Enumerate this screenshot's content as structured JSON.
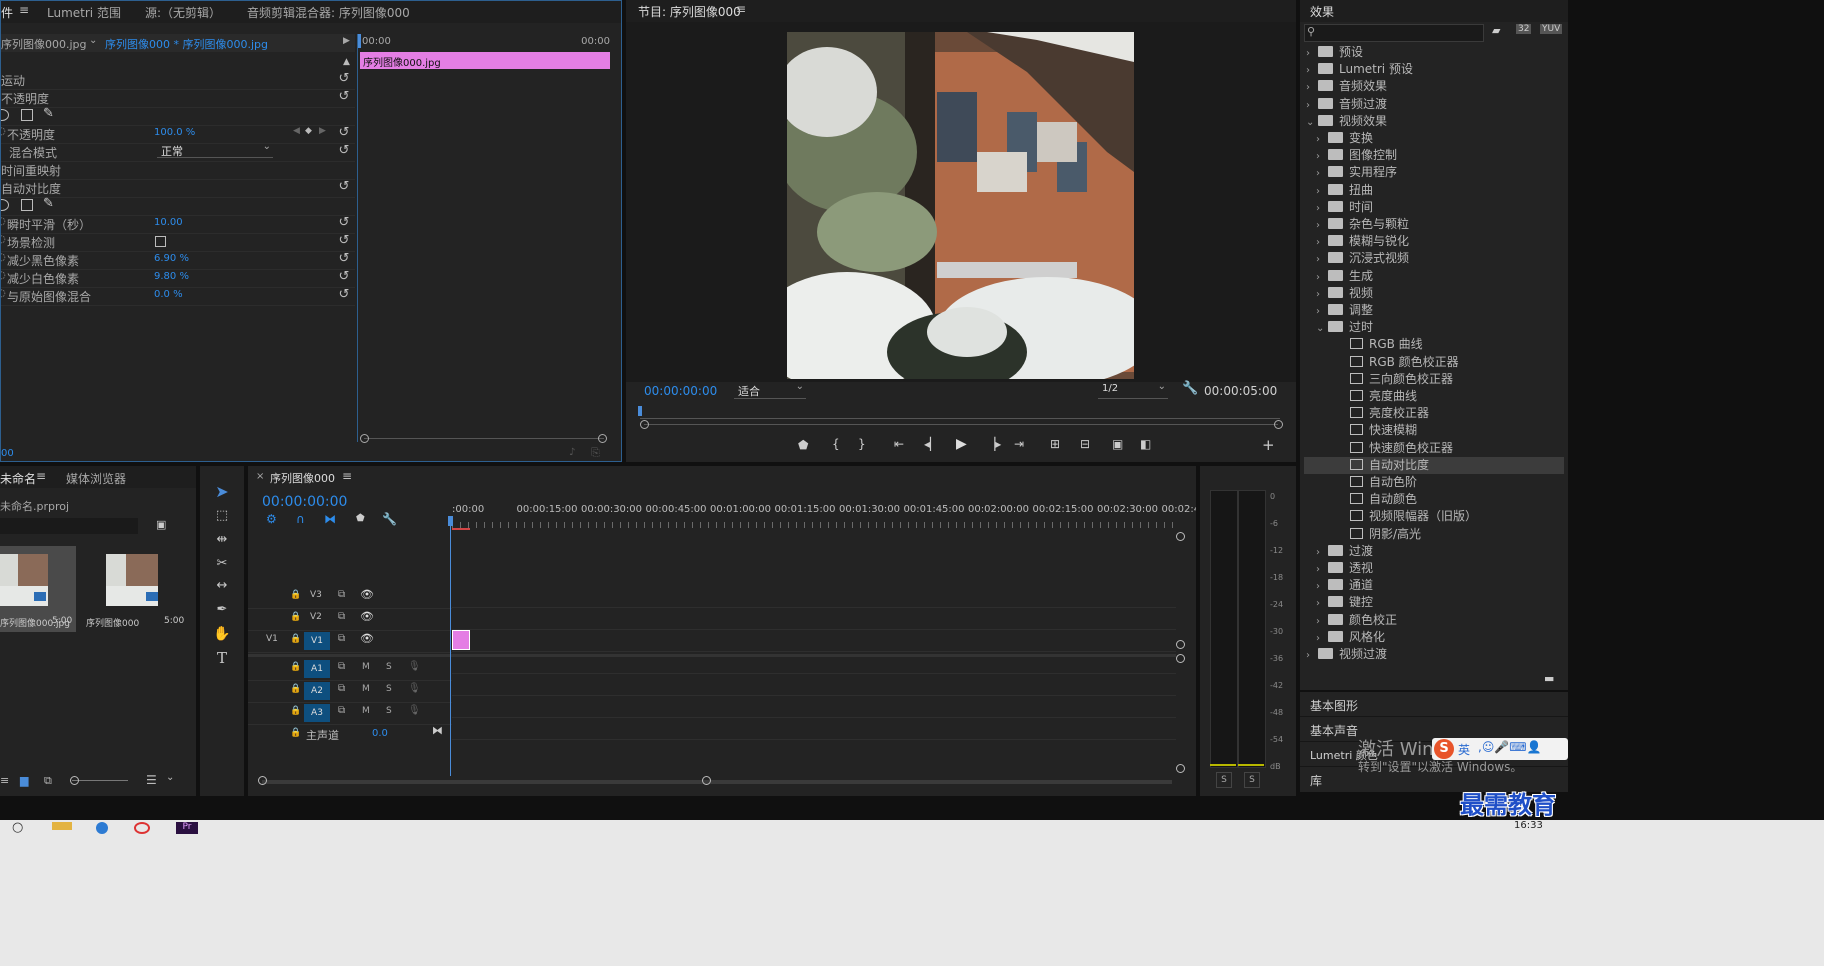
{
  "effect_controls": {
    "tabs": [
      "件",
      "Lumetri 范围",
      "源:（无剪辑）",
      "音频剪辑混合器: 序列图像000"
    ],
    "clip_path_master": "序列图像000.jpg",
    "clip_path_seq": "序列图像000 * 序列图像000.jpg",
    "time_start": "00:00",
    "time_end": "00:00",
    "clip_label": "序列图像000.jpg",
    "bottom_time": "00",
    "rows": {
      "motion": "运动",
      "opacity_group": "不透明度",
      "opacity": "不透明度",
      "opacity_value": "100.0 %",
      "blend": "混合模式",
      "blend_value": "正常",
      "time_remap": "时间重映射",
      "auto_contrast": "自动对比度",
      "temporal_smooth": "瞬时平滑（秒）",
      "temporal_smooth_value": "10.00",
      "scene_detect": "场景检测",
      "black_clip": "减少黑色像素",
      "black_clip_value": "6.90 %",
      "white_clip": "减少白色像素",
      "white_clip_value": "9.80 %",
      "blend_original": "与原始图像混合",
      "blend_original_value": "0.0 %"
    }
  },
  "program": {
    "title": "节目: 序列图像000",
    "timecode": "00:00:00:00",
    "fit": "适合",
    "resolution": "1/2",
    "duration": "00:00:05:00"
  },
  "effects": {
    "title": "效果",
    "items": [
      {
        "label": "预设",
        "level": 0,
        "kind": "folder",
        "open": false
      },
      {
        "label": "Lumetri 预设",
        "level": 0,
        "kind": "folder",
        "open": false
      },
      {
        "label": "音频效果",
        "level": 0,
        "kind": "folder",
        "open": false
      },
      {
        "label": "音频过渡",
        "level": 0,
        "kind": "folder",
        "open": false
      },
      {
        "label": "视频效果",
        "level": 0,
        "kind": "folder",
        "open": true
      },
      {
        "label": "变换",
        "level": 1,
        "kind": "folder",
        "open": false
      },
      {
        "label": "图像控制",
        "level": 1,
        "kind": "folder",
        "open": false
      },
      {
        "label": "实用程序",
        "level": 1,
        "kind": "folder",
        "open": false
      },
      {
        "label": "扭曲",
        "level": 1,
        "kind": "folder",
        "open": false
      },
      {
        "label": "时间",
        "level": 1,
        "kind": "folder",
        "open": false
      },
      {
        "label": "杂色与颗粒",
        "level": 1,
        "kind": "folder",
        "open": false
      },
      {
        "label": "模糊与锐化",
        "level": 1,
        "kind": "folder",
        "open": false
      },
      {
        "label": "沉浸式视频",
        "level": 1,
        "kind": "folder",
        "open": false
      },
      {
        "label": "生成",
        "level": 1,
        "kind": "folder",
        "open": false
      },
      {
        "label": "视频",
        "level": 1,
        "kind": "folder",
        "open": false
      },
      {
        "label": "调整",
        "level": 1,
        "kind": "folder",
        "open": false
      },
      {
        "label": "过时",
        "level": 1,
        "kind": "folder",
        "open": true
      },
      {
        "label": "RGB 曲线",
        "level": 2,
        "kind": "fx"
      },
      {
        "label": "RGB 颜色校正器",
        "level": 2,
        "kind": "fx"
      },
      {
        "label": "三向颜色校正器",
        "level": 2,
        "kind": "fx"
      },
      {
        "label": "亮度曲线",
        "level": 2,
        "kind": "fx"
      },
      {
        "label": "亮度校正器",
        "level": 2,
        "kind": "fx"
      },
      {
        "label": "快速模糊",
        "level": 2,
        "kind": "fx"
      },
      {
        "label": "快速颜色校正器",
        "level": 2,
        "kind": "fx"
      },
      {
        "label": "自动对比度",
        "level": 2,
        "kind": "fx",
        "selected": true
      },
      {
        "label": "自动色阶",
        "level": 2,
        "kind": "fx"
      },
      {
        "label": "自动颜色",
        "level": 2,
        "kind": "fx"
      },
      {
        "label": "视频限幅器（旧版）",
        "level": 2,
        "kind": "fx"
      },
      {
        "label": "阴影/高光",
        "level": 2,
        "kind": "fx"
      },
      {
        "label": "过渡",
        "level": 1,
        "kind": "folder",
        "open": false
      },
      {
        "label": "透视",
        "level": 1,
        "kind": "folder",
        "open": false
      },
      {
        "label": "通道",
        "level": 1,
        "kind": "folder",
        "open": false
      },
      {
        "label": "键控",
        "level": 1,
        "kind": "folder",
        "open": false
      },
      {
        "label": "颜色校正",
        "level": 1,
        "kind": "folder",
        "open": false
      },
      {
        "label": "风格化",
        "level": 1,
        "kind": "folder",
        "open": false
      },
      {
        "label": "视频过渡",
        "level": 0,
        "kind": "folder",
        "open": false
      }
    ],
    "sections": [
      "基本图形",
      "基本声音",
      "Lumetri 颜色",
      "库"
    ]
  },
  "project": {
    "tab_project": "未命名",
    "tab_media": "媒体浏览器",
    "file": "未命名.prproj",
    "items": [
      {
        "name": "序列图像000.jpg",
        "duration": "5:00"
      },
      {
        "name": "序列图像000",
        "duration": "5:00"
      }
    ]
  },
  "timeline": {
    "tab": "序列图像000",
    "timecode": "00:00:00:00",
    "ruler": [
      ":00:00",
      "00:00:15:00",
      "00:00:30:00",
      "00:00:45:00",
      "00:01:00:00",
      "00:01:15:00",
      "00:01:30:00",
      "00:01:45:00",
      "00:02:00:00",
      "00:02:15:00",
      "00:02:30:00",
      "00:02:45:"
    ],
    "video_tracks": [
      "V3",
      "V2",
      "V1"
    ],
    "audio_tracks": [
      "A1",
      "A2",
      "A3"
    ],
    "source_patch": "V1",
    "master_label": "主声道",
    "master_value": "0.0"
  },
  "meter": {
    "scale": [
      "0",
      "-6",
      "-12",
      "-18",
      "-24",
      "-30",
      "-36",
      "-42",
      "-48",
      "-54",
      "dB"
    ],
    "solo": [
      "S",
      "S"
    ]
  },
  "watermark": {
    "line1": "激活 Win",
    "line2": "转到\"设置\"以激活 Windows。",
    "brand": "最需教育",
    "ime": "英"
  },
  "taskbar": {
    "clock": "16:33"
  },
  "colors": {
    "accent_blue": "#2d8ceb",
    "clip_pink": "#e47ee4",
    "playhead": "#4a8cd9"
  }
}
